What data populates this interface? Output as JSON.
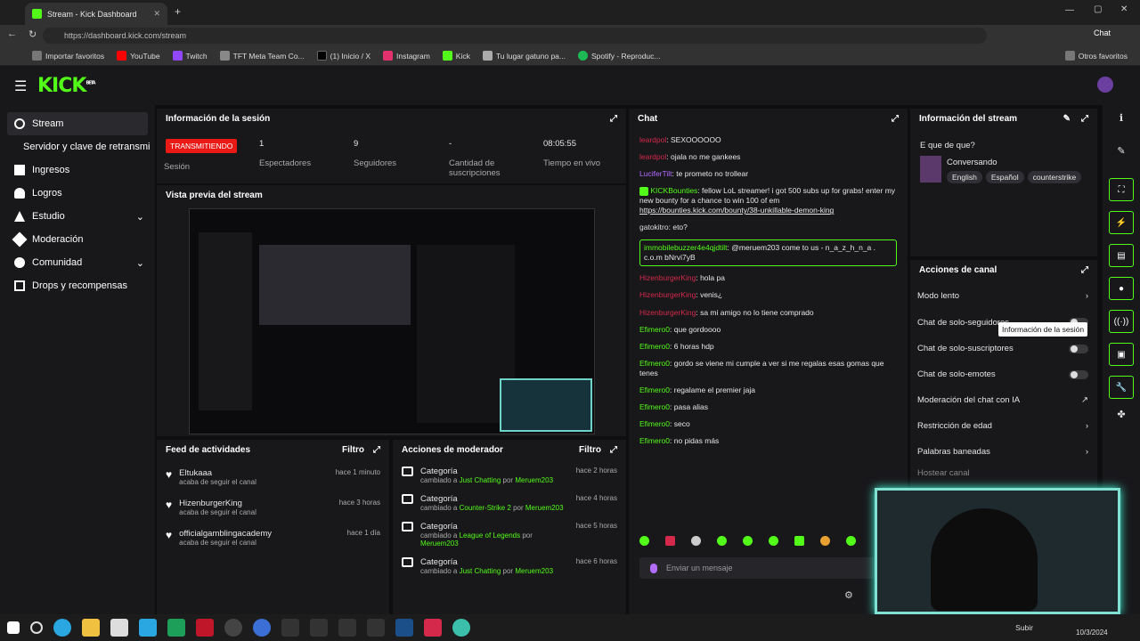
{
  "browser": {
    "tab_title": "Stream - Kick Dashboard",
    "url": "https://dashboard.kick.com/stream",
    "chat_btn": "Chat",
    "bookmarks": [
      "Importar favoritos",
      "YouTube",
      "Twitch",
      "TFT Meta Team Co...",
      "(1) Inicio / X",
      "Instagram",
      "Kick",
      "Tu lugar gatuno pa...",
      "Spotify - Reproduc..."
    ],
    "other_bookmarks": "Otros favoritos"
  },
  "header": {
    "logo": "KICK",
    "beta": "BETA"
  },
  "sidebar": {
    "items": [
      "Stream",
      "Servidor y clave de retransmi",
      "Ingresos",
      "Logros",
      "Estudio",
      "Moderación",
      "Comunidad",
      "Drops y recompensas"
    ]
  },
  "session": {
    "title": "Información de la sesión",
    "status": "TRANSMITIENDO",
    "status_label": "Sesión",
    "stats": [
      {
        "value": "1",
        "label": "Espectadores"
      },
      {
        "value": "9",
        "label": "Seguidores"
      },
      {
        "value": "-",
        "label": "Cantidad de suscripciones"
      },
      {
        "value": "08:05:55",
        "label": "Tiempo en vivo"
      }
    ]
  },
  "preview": {
    "title": "Vista previa del stream"
  },
  "activity": {
    "title": "Feed de actividades",
    "filter": "Filtro",
    "items": [
      {
        "name": "Eltukaaa",
        "desc": "acaba de seguir el canal",
        "time": "hace 1 minuto"
      },
      {
        "name": "HizenburgerKing",
        "desc": "acaba de seguir el canal",
        "time": "hace 3 horas"
      },
      {
        "name": "officialgamblingacademy",
        "desc": "acaba de seguir el canal",
        "time": "hace 1 día"
      }
    ]
  },
  "modactions": {
    "title": "Acciones de moderador",
    "filter": "Filtro",
    "items": [
      {
        "title": "Categoría",
        "pre": "cambiado a",
        "cat": "Just Chatting",
        "by": "por",
        "user": "Meruem203",
        "time": "hace 2 horas"
      },
      {
        "title": "Categoría",
        "pre": "cambiado a",
        "cat": "Counter-Strike 2",
        "by": "por",
        "user": "Meruem203",
        "time": "hace 4 horas"
      },
      {
        "title": "Categoría",
        "pre": "cambiado a",
        "cat": "League of Legends",
        "by": "por",
        "user": "Meruem203",
        "time": "hace 5 horas"
      },
      {
        "title": "Categoría",
        "pre": "cambiado a",
        "cat": "Just Chatting",
        "by": "por",
        "user": "Meruem203",
        "time": "hace 6 horas"
      }
    ]
  },
  "chat": {
    "title": "Chat",
    "messages": [
      {
        "user": "leardpol",
        "color": "r",
        "text": "SEXOOOOOO"
      },
      {
        "user": "leardpol",
        "color": "r",
        "text": "ojala no me gankees"
      },
      {
        "user": "LuciferTilt",
        "color": "p",
        "text": "te prometo no trollear"
      },
      {
        "user": "KICKBounties",
        "color": "g",
        "text": "fellow LoL streamer! i got 500 subs up for grabs! enter my new bounty for a chance to win 100 of em"
      },
      {
        "user": "gatokitro",
        "color": "w",
        "text": "eto?"
      },
      {
        "user": "immobilebuzzer4e4qjdtilt",
        "color": "g",
        "text": "@meruem203 come to us - n_a_z_h_n_a . c.o.m bNrvi7yB"
      },
      {
        "user": "HizenburgerKing",
        "color": "r",
        "text": "hola pa"
      },
      {
        "user": "HizenburgerKing",
        "color": "r",
        "text": "venis¿"
      },
      {
        "user": "HizenburgerKing",
        "color": "r",
        "text": "sa mi amigo no lo tiene comprado"
      },
      {
        "user": "Efimero0",
        "color": "g",
        "text": "que gordoooo"
      },
      {
        "user": "Efimero0",
        "color": "g",
        "text": "6 horas hdp"
      },
      {
        "user": "Efimero0",
        "color": "g",
        "text": "gordo se viene mi cumple a ver si me regalas esas gomas que tenes"
      },
      {
        "user": "Efimero0",
        "color": "g",
        "text": "regalame el premier jaja"
      },
      {
        "user": "Efimero0",
        "color": "g",
        "text": "pasa alias"
      },
      {
        "user": "Efimero0",
        "color": "g",
        "text": "seco"
      },
      {
        "user": "Efimero0",
        "color": "g",
        "text": "no pidas más"
      }
    ],
    "bounty_link": "https://bounties.kick.com/bounty/38-unkillable-demon-king",
    "placeholder": "Enviar un mensaje"
  },
  "streaminfo": {
    "title": "Información del stream",
    "stream_title": "E que de que?",
    "category": "Conversando",
    "tags": [
      "English",
      "Español",
      "counterstrike"
    ]
  },
  "channel": {
    "title": "Acciones de canal",
    "items": [
      "Modo lento",
      "Chat de solo-seguidores",
      "Chat de solo-suscriptores",
      "Chat de solo-emotes",
      "Moderación del chat con IA",
      "Restricción de edad",
      "Palabras baneadas",
      "Hostear canal"
    ],
    "tooltip": "Información de la sesión"
  },
  "taskbar": {
    "subir": "Subir",
    "date": "10/3/2024"
  },
  "colors": {
    "accent": "#53fc18",
    "live": "#e91916",
    "bg": "#0e0e10",
    "panel": "#18181b"
  }
}
